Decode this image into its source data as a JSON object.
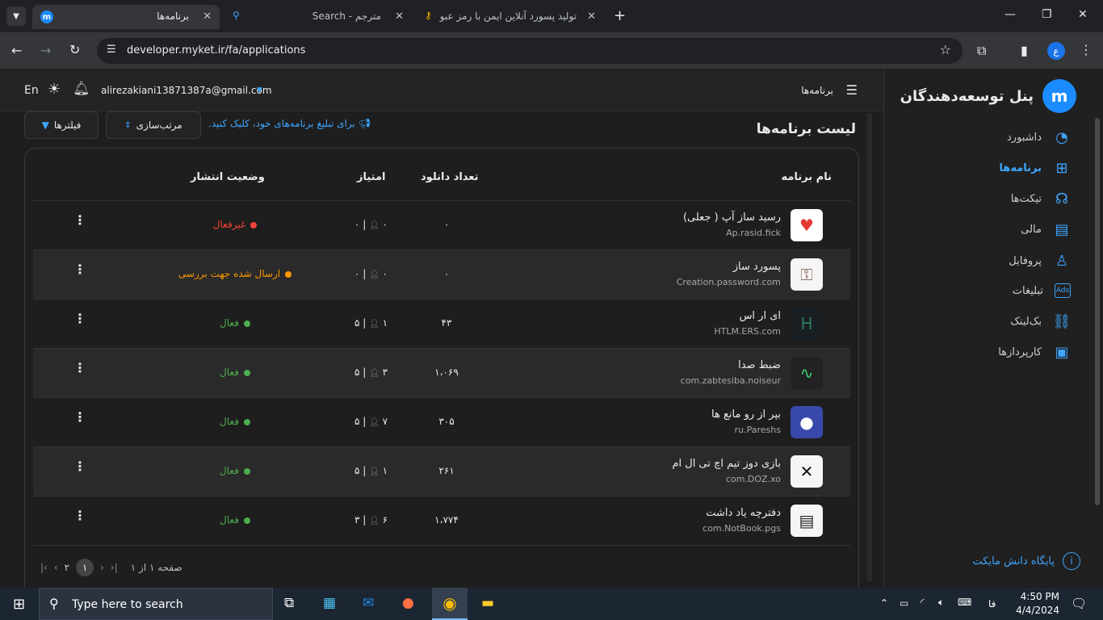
{
  "browser": {
    "tabs": [
      {
        "title": "برنامه‌ها",
        "active": true
      },
      {
        "title": "مترجم - Search",
        "active": false
      },
      {
        "title": "تولید پسورد آنلاین ایمن با رمز عبور",
        "active": false
      }
    ],
    "url": "developer.myket.ir/fa/applications",
    "profile_initial": "ع"
  },
  "sidebar": {
    "title": "پنل توسعه‌دهندگان",
    "items": [
      {
        "label": "داشبورد",
        "icon": "dashboard-icon",
        "active": false
      },
      {
        "label": "برنامه‌ها",
        "icon": "apps-icon",
        "active": true
      },
      {
        "label": "تیکت‌ها",
        "icon": "headset-icon",
        "active": false
      },
      {
        "label": "مالی",
        "icon": "finance-icon",
        "active": false
      },
      {
        "label": "پروفایل",
        "icon": "profile-icon",
        "active": false
      },
      {
        "label": "تبلیغات",
        "icon": "ads-icon",
        "active": false
      },
      {
        "label": "بک‌لینک",
        "icon": "link-icon",
        "active": false
      },
      {
        "label": "کارپردازها",
        "icon": "agents-icon",
        "active": false
      }
    ],
    "knowledge_base": "پایگاه دانش مایکت"
  },
  "topbar": {
    "lang": "En",
    "email": "alirezakiani13871387a@gmail.com",
    "breadcrumb": "برنامه‌ها"
  },
  "list": {
    "title": "لیست برنامه‌ها",
    "promo": "برای تبلیغ برنامه‌های خود، کلیک کنید.",
    "sort_label": "مرتب‌سازی",
    "filter_label": "فیلترها",
    "headers": {
      "name": "نام برنامه",
      "downloads": "تعداد دانلود",
      "rating": "امتیاز",
      "status": "وضعیت انتشار"
    },
    "rows": [
      {
        "name": "رسید ساز آپ ( جعلی)",
        "package": "Ap.rasid.fick",
        "downloads": "۰",
        "rating": "۰",
        "votes": "۰",
        "status": "غیرفعال",
        "status_color": "#f44336",
        "icon_bg": "#ffffff",
        "icon_fg": "#e53935",
        "icon_glyph": "♥"
      },
      {
        "name": "پسورد ساز",
        "package": "Creation.password.com",
        "downloads": "۰",
        "rating": "۰",
        "votes": "۰",
        "status": "ارسال شده جهت بررسی",
        "status_color": "#ff9800",
        "icon_bg": "#f5f5f5",
        "icon_fg": "#8d6e63",
        "icon_glyph": "⚿"
      },
      {
        "name": "ای ار اس",
        "package": "HTLM.ERS.com",
        "downloads": "۴۳",
        "rating": "۱",
        "votes": "۵",
        "status": "فعال",
        "status_color": "#4caf50",
        "icon_bg": "#1a1f24",
        "icon_fg": "#2e7d5b",
        "icon_glyph": "H"
      },
      {
        "name": "ضبط صدا",
        "package": "com.zabtesiba.noiseur",
        "downloads": "۱،۰۶۹",
        "rating": "۳",
        "votes": "۵",
        "status": "فعال",
        "status_color": "#4caf50",
        "icon_bg": "#222",
        "icon_fg": "#43d17a",
        "icon_glyph": "∿"
      },
      {
        "name": "بپر از رو مانع ها",
        "package": "ru.Pareshs",
        "downloads": "۳۰۵",
        "rating": "۷",
        "votes": "۵",
        "status": "فعال",
        "status_color": "#4caf50",
        "icon_bg": "#3949ab",
        "icon_fg": "#ffffff",
        "icon_glyph": "●"
      },
      {
        "name": "بازی دوز تیم اچ تی ال ام",
        "package": "com.DOZ.xo",
        "downloads": "۲۶۱",
        "rating": "۱",
        "votes": "۵",
        "status": "فعال",
        "status_color": "#4caf50",
        "icon_bg": "#f5f5f5",
        "icon_fg": "#111111",
        "icon_glyph": "✕"
      },
      {
        "name": "دفترچه یاد داشت",
        "package": "com.NotBook.pgs",
        "downloads": "۱،۷۷۴",
        "rating": "۶",
        "votes": "۳",
        "status": "فعال",
        "status_color": "#4caf50",
        "icon_bg": "#f5f5f5",
        "icon_fg": "#222222",
        "icon_glyph": "▤"
      }
    ],
    "pagination": {
      "label": "صفحه ۱ از ۱",
      "current": "۱",
      "next": "۲"
    }
  },
  "taskbar": {
    "search_placeholder": "Type here to search",
    "time": "4:50 PM",
    "date": "4/4/2024",
    "lang": "فا"
  },
  "colors": {
    "accent": "#3ea6ff",
    "active": "#4caf50",
    "inactive": "#f44336",
    "pending": "#ff9800"
  }
}
